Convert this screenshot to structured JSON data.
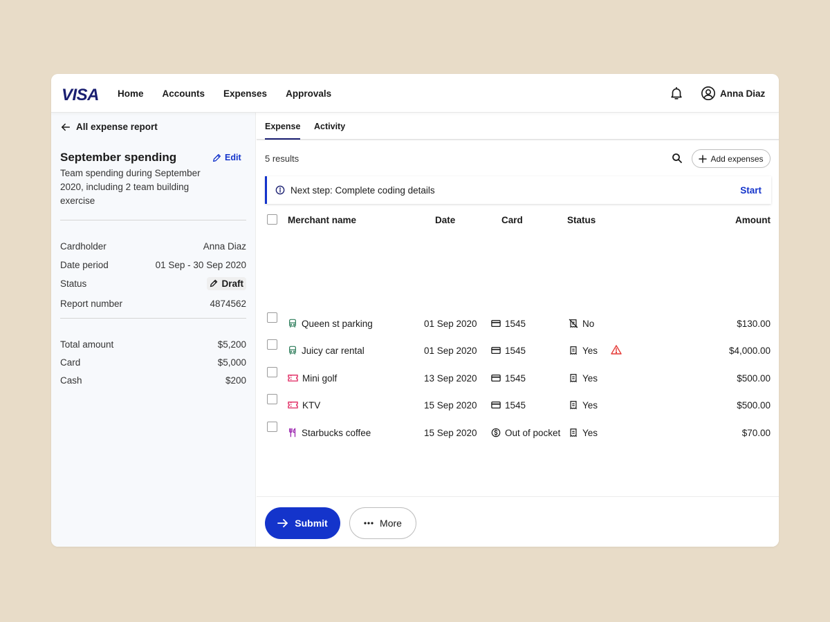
{
  "brand": {
    "logo_text": "VISA",
    "primary_color": "#1434cb",
    "navy": "#1a1f71"
  },
  "nav": {
    "items": [
      "Home",
      "Accounts",
      "Expenses",
      "Approvals"
    ]
  },
  "user": {
    "name": "Anna Diaz"
  },
  "report": {
    "back_label": "All expense report",
    "title": "September spending",
    "edit_label": "Edit",
    "description": "Team spending during September 2020, including 2 team building exercise",
    "details": [
      {
        "label": "Cardholder",
        "value": "Anna Diaz"
      },
      {
        "label": "Date period",
        "value": "01 Sep - 30 Sep 2020"
      },
      {
        "label": "Status",
        "value": "Draft"
      },
      {
        "label": "Report number",
        "value": "4874562"
      }
    ],
    "totals": [
      {
        "label": "Total amount",
        "value": "$5,200"
      },
      {
        "label": "Card",
        "value": "$5,000"
      },
      {
        "label": "Cash",
        "value": "$200"
      }
    ]
  },
  "tabs": {
    "items": [
      "Expense",
      "Activity"
    ],
    "active": "Expense"
  },
  "toolbar": {
    "results": "5 results",
    "add_label": "Add expenses"
  },
  "banner": {
    "text": "Next step: Complete coding details",
    "action": "Start"
  },
  "table": {
    "headers": {
      "merchant": "Merchant name",
      "date": "Date",
      "card": "Card",
      "status": "Status",
      "amount": "Amount"
    },
    "rows": [
      {
        "merchant": "Queen st parking",
        "category_icon": "transport-icon",
        "category_color": "#2e7d5b",
        "date": "01 Sep 2020",
        "card": "1545",
        "card_icon": "credit-card-icon",
        "status": "No",
        "status_icon": "no-receipt-icon",
        "warning": false,
        "amount": "$130.00"
      },
      {
        "merchant": "Juicy car rental",
        "category_icon": "transport-icon",
        "category_color": "#2e7d5b",
        "date": "01 Sep 2020",
        "card": "1545",
        "card_icon": "credit-card-icon",
        "status": "Yes",
        "status_icon": "receipt-icon",
        "warning": true,
        "amount": "$4,000.00"
      },
      {
        "merchant": "Mini golf",
        "category_icon": "ticket-icon",
        "category_color": "#e0245e",
        "date": "13 Sep 2020",
        "card": "1545",
        "card_icon": "credit-card-icon",
        "status": "Yes",
        "status_icon": "receipt-icon",
        "warning": false,
        "amount": "$500.00"
      },
      {
        "merchant": "KTV",
        "category_icon": "ticket-icon",
        "category_color": "#e0245e",
        "date": "15 Sep 2020",
        "card": "1545",
        "card_icon": "credit-card-icon",
        "status": "Yes",
        "status_icon": "receipt-icon",
        "warning": false,
        "amount": "$500.00"
      },
      {
        "merchant": "Starbucks coffee",
        "category_icon": "cutlery-icon",
        "category_color": "#9c27b0",
        "date": "15 Sep 2020",
        "card": "Out of pocket",
        "card_icon": "dollar-circle-icon",
        "status": "Yes",
        "status_icon": "receipt-icon",
        "warning": false,
        "amount": "$70.00"
      }
    ]
  },
  "footer": {
    "submit_label": "Submit",
    "more_label": "More"
  }
}
